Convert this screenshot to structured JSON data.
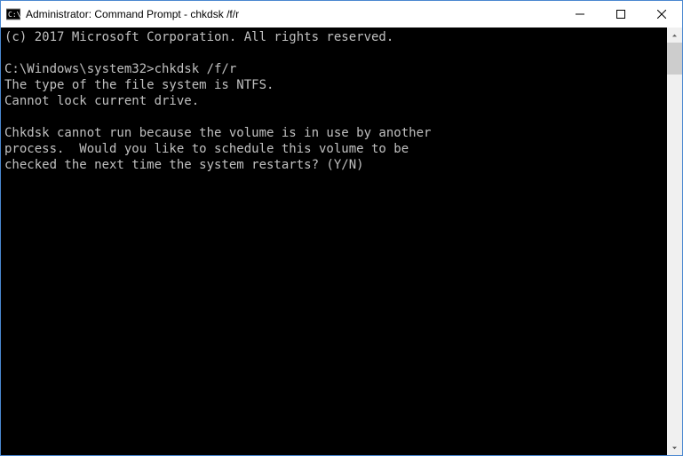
{
  "window": {
    "title": "Administrator: Command Prompt - chkdsk  /f/r"
  },
  "console": {
    "copyright": "(c) 2017 Microsoft Corporation. All rights reserved.",
    "prompt": "C:\\Windows\\system32>",
    "command": "chkdsk /f/r",
    "line_fs": "The type of the file system is NTFS.",
    "line_lock": "Cannot lock current drive.",
    "msg1": "Chkdsk cannot run because the volume is in use by another",
    "msg2": "process.  Would you like to schedule this volume to be",
    "msg3": "checked the next time the system restarts? (Y/N)"
  }
}
